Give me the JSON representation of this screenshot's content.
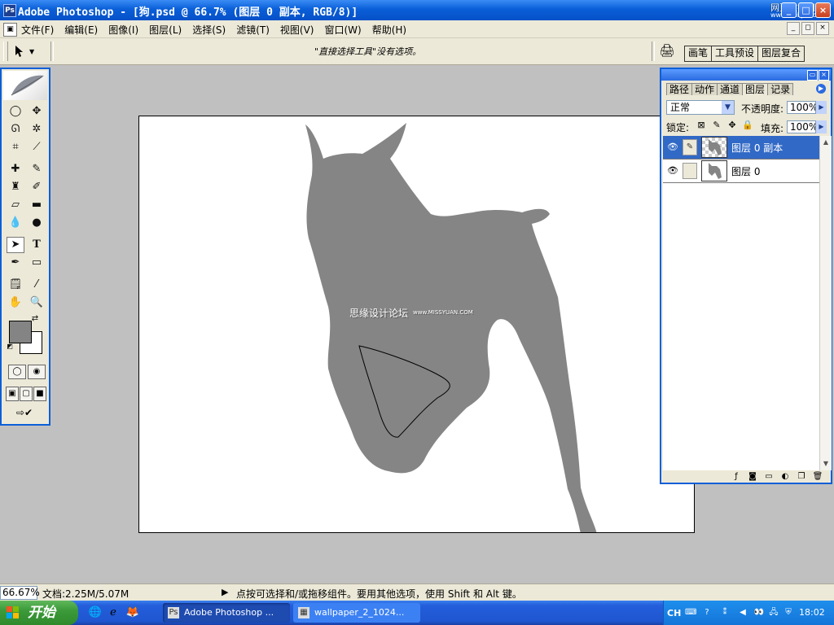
{
  "window": {
    "title": "Adobe Photoshop - [狗.psd @ 66.7% (图层 0 副本, RGB/8)]",
    "watermark": "网页教学网",
    "watermark_url": "www.webjx.com"
  },
  "menu": {
    "items": [
      "文件(F)",
      "编辑(E)",
      "图像(I)",
      "图层(L)",
      "选择(S)",
      "滤镜(T)",
      "视图(V)",
      "窗口(W)",
      "帮助(H)"
    ]
  },
  "options_bar": {
    "hint": "\"直接选择工具\"没有选项。",
    "well_tabs": [
      "画笔",
      "工具预设",
      "图层复合"
    ]
  },
  "canvas": {
    "watermark_cn": "思缘设计论坛",
    "watermark_url": "www.MISSYUAN.COM",
    "fg_color": "#848484",
    "bg_color": "#ffffff"
  },
  "layers_panel": {
    "tabs": [
      "路径",
      "动作",
      "通道",
      "图层",
      "记录"
    ],
    "active_tab": "图层",
    "blend_mode": "正常",
    "opacity_label": "不透明度:",
    "opacity": "100%",
    "lock_label": "锁定:",
    "fill_label": "填充:",
    "fill": "100%",
    "layers": [
      {
        "name": "图层 0 副本",
        "selected": true
      },
      {
        "name": "图层 0",
        "selected": false
      }
    ]
  },
  "status_bar": {
    "zoom": "66.67%",
    "doc_info": "文档:2.25M/5.07M",
    "tip": "点按可选择和/或拖移组件。要用其他选项，使用 Shift 和 Alt 键。"
  },
  "taskbar": {
    "start_label": "开始",
    "tasks": [
      {
        "label": "Adobe Photoshop ...",
        "active": true
      },
      {
        "label": "wallpaper_2_1024...",
        "active": false
      }
    ],
    "language": "CH",
    "clock": "18:02"
  },
  "colors": {
    "xp_blue": "#0a5fd8",
    "selection_blue": "#3169c6",
    "silhouette_gray": "#858585"
  }
}
